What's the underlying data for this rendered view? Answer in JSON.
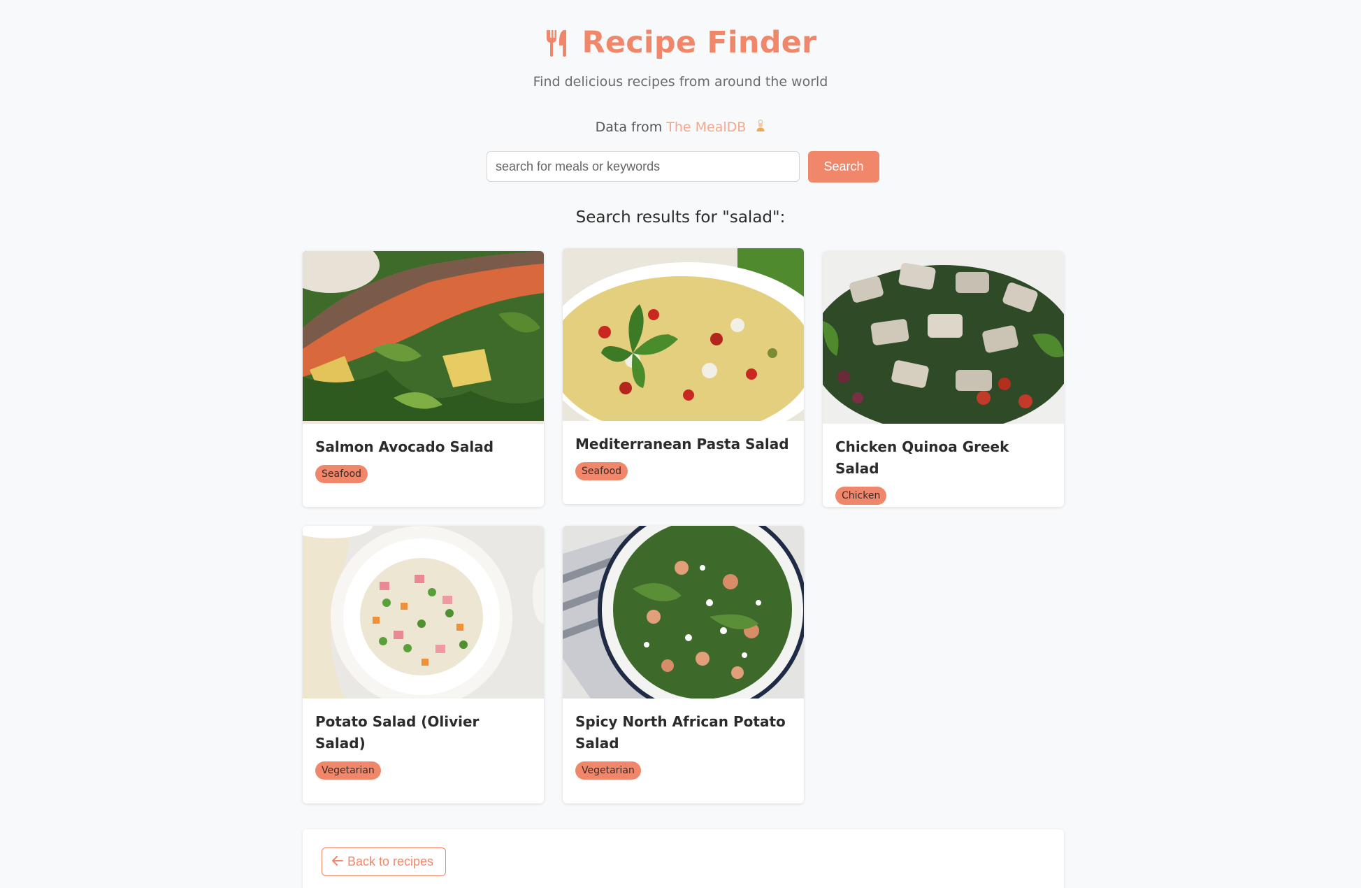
{
  "header": {
    "title": "Recipe Finder",
    "logo_icon": "utensils-icon",
    "subtitle": "Find delicious recipes from around the world"
  },
  "attribution": {
    "prefix": "Data from",
    "link_text": "The MealDB",
    "icon": "chef-icon"
  },
  "search": {
    "placeholder": "search for meals or keywords",
    "value": "",
    "button_label": "Search"
  },
  "results": {
    "heading": "Search results for \"salad\":",
    "cards": [
      {
        "title": "Salmon Avocado Salad",
        "category": "Seafood"
      },
      {
        "title": "Mediterranean Pasta Salad",
        "category": "Seafood"
      },
      {
        "title": "Chicken Quinoa Greek Salad",
        "category": "Chicken"
      },
      {
        "title": "Potato Salad (Olivier Salad)",
        "category": "Vegetarian"
      },
      {
        "title": "Spicy North African Potato Salad",
        "category": "Vegetarian"
      }
    ]
  },
  "footer": {
    "back_label": "Back to recipes",
    "back_icon": "arrow-left-icon"
  },
  "colors": {
    "accent": "#f0876a",
    "link": "#f4a78f",
    "background": "#f8f9fa"
  }
}
